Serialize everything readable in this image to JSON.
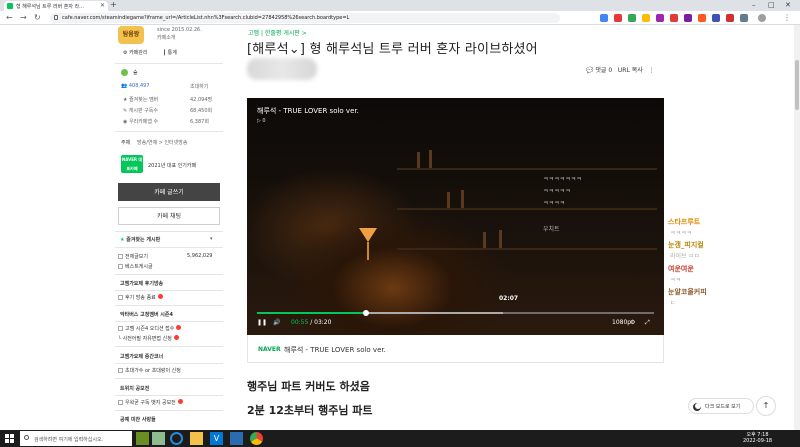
{
  "browser": {
    "tab_title": "형 해루석님 트루 러버 혼자 라...",
    "new_tab": "+",
    "url": "cafe.naver.com/steamindiegame?iframe_url=/ArticleList.nhn%3Fsearch.clubid=27842958%26search.boardtype=L",
    "controls": {
      "minimize": "–",
      "maximize": "□",
      "close": "✕"
    },
    "nav": {
      "back": "←",
      "forward": "→",
      "reload": "↻"
    }
  },
  "sidebar": {
    "cafe_badge": "탐움왕",
    "since": "since 2015.02.26.",
    "since_sub": "카페소개",
    "manage": "카페관리",
    "stats": "통계",
    "level_label": "숲",
    "members": "408,497",
    "invite": "초대하기",
    "rows": [
      {
        "label": "즐겨찾는 멤버",
        "value": "42,094명"
      },
      {
        "label": "게시판 구독수",
        "value": "68,450회"
      },
      {
        "label": "우리카페앱 수",
        "value": "6,387회"
      }
    ],
    "topic_label": "주제",
    "topic_value": "방송/연예 > 인터넷방송",
    "award_badge": "NAVER 대표카페",
    "award_text": "2021년 대표 인기카페",
    "write_button": "카페 글쓰기",
    "chat_button": "카페 채팅",
    "fav_boards": "즐겨찾는 게시판",
    "all_posts": "전체글보기",
    "all_posts_count": "5,962,029",
    "best_posts": "베스트게시글",
    "sections": [
      {
        "title": "고멤가요제 후기방송",
        "items": [
          "후기 방송 종료"
        ]
      },
      {
        "title": "악타버스 고정멤버 시즌4",
        "items": [
          "고멤 시즌4 오디션 접수",
          "사전어필 자유면접 신청"
        ]
      },
      {
        "title": "고멤가요제 중간코너",
        "items": [
          "초대가수 or 초대랑이 신청"
        ]
      },
      {
        "title": "트위치 공모전",
        "items": [
          "우왁굳 구독 뱃지 공모전"
        ]
      },
      {
        "title": "공예 미잔 사랑들",
        "items": []
      }
    ]
  },
  "article": {
    "breadcrumb": "고멤 | 한줄평 게시판 >",
    "title": "[해루석⌄] 형 해루석님 트루 러버 혼자 라이브하셨어",
    "comments": "댓글 0",
    "url_copy": "URL 복사",
    "more": "⋮",
    "body_lines": [
      "행주님 파트 커버도 하셨음",
      "2분 12초부터 행주님 파트"
    ]
  },
  "video": {
    "title": "해루석 - TRUE LOVER solo ver.",
    "play_label": "▷ 0",
    "tooltip_time": "02:07",
    "current_time": "00:55",
    "duration": "03:20",
    "quality": "1080p",
    "progress_fraction": 0.275,
    "buffered_fraction": 0.62,
    "caption_source": "NAVER",
    "caption_title": "해루석 - TRUE LOVER solo ver.",
    "overlay_chat": [
      "ㅋㅋㅋㅋㅋㅋㅋ",
      "ㅋㅋㅋㅋㅋ",
      "ㅋㅋㅋㅋ",
      "우치트"
    ]
  },
  "right_chat": [
    {
      "name": "스타프루트",
      "msg": "ㅋㅋㅋㅋ",
      "color": "#e08a00"
    },
    {
      "name": "눈갱_피지컬",
      "msg": "라이브 ㅁㅁ",
      "color": "#b8860b"
    },
    {
      "name": "여운여운",
      "msg": "ㅋㅋ",
      "color": "#c0392b"
    },
    {
      "name": "눈알코올커피",
      "msg": "ㄷ",
      "color": "#8b5a2b"
    }
  ],
  "floating": {
    "dark_mode": "다크 모드로 보기",
    "to_top": "↑"
  },
  "taskbar": {
    "search_placeholder": "검색하려면 여기에 입력하십시오.",
    "time": "오후 7:18",
    "date": "2022-09-18"
  },
  "colors": {
    "naver_green": "#03c75a",
    "title_text": "#222222",
    "link_blue": "#3a70c8"
  }
}
